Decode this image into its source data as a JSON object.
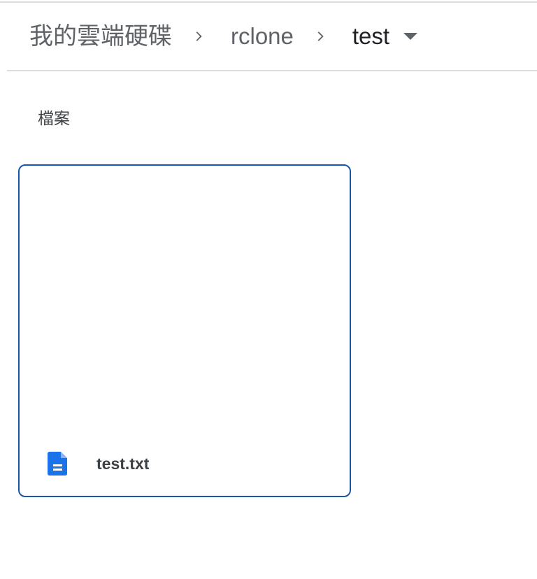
{
  "breadcrumb": {
    "items": [
      {
        "label": "我的雲端硬碟"
      },
      {
        "label": "rclone"
      },
      {
        "label": "test"
      }
    ]
  },
  "section": {
    "files_label": "檔案"
  },
  "files": [
    {
      "name": "test.txt",
      "icon": "doc-icon"
    }
  ],
  "colors": {
    "text_primary": "#202124",
    "text_secondary": "#5f6368",
    "divider": "#dadce0",
    "selection_border": "#1a56b0",
    "doc_icon": "#1a73e8"
  }
}
